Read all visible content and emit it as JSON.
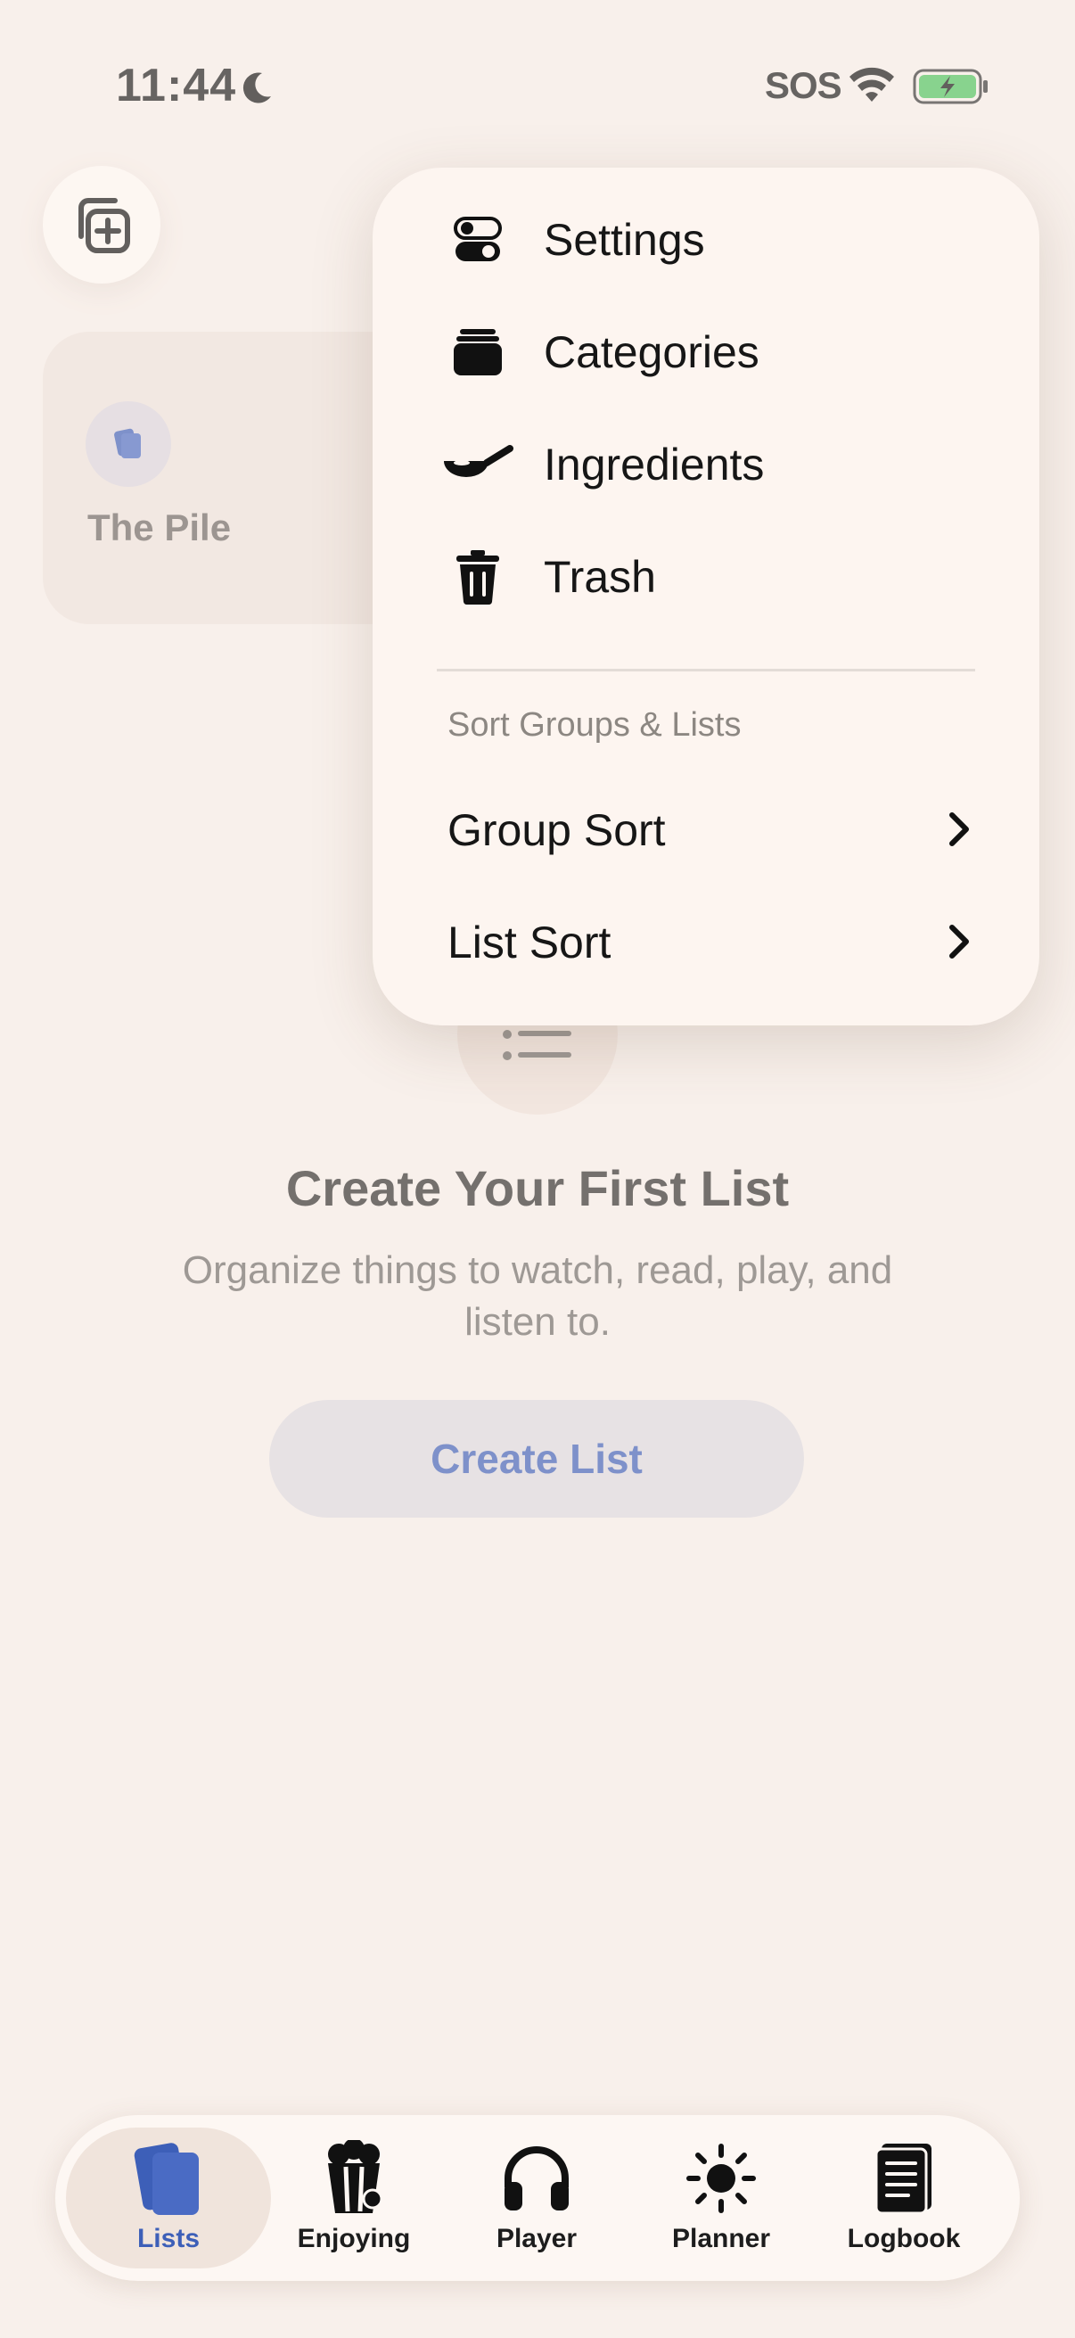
{
  "status_bar": {
    "time": "11:44",
    "carrier": "SOS"
  },
  "pile": {
    "title": "The Pile"
  },
  "empty_state": {
    "title": "Create Your First List",
    "subtitle": "Organize things to watch, read, play, and listen to.",
    "button_label": "Create List"
  },
  "menu": {
    "items": [
      {
        "label": "Settings",
        "icon": "toggles-icon"
      },
      {
        "label": "Categories",
        "icon": "stack-icon"
      },
      {
        "label": "Ingredients",
        "icon": "frying-pan-icon"
      },
      {
        "label": "Trash",
        "icon": "trash-icon"
      }
    ],
    "section_title": "Sort Groups & Lists",
    "sort_items": [
      {
        "label": "Group Sort"
      },
      {
        "label": "List Sort"
      }
    ]
  },
  "tabbar": {
    "tabs": [
      {
        "label": "Lists",
        "icon": "cards-icon",
        "active": true
      },
      {
        "label": "Enjoying",
        "icon": "popcorn-icon",
        "active": false
      },
      {
        "label": "Player",
        "icon": "headphones-icon",
        "active": false
      },
      {
        "label": "Planner",
        "icon": "sun-icon",
        "active": false
      },
      {
        "label": "Logbook",
        "icon": "notebook-icon",
        "active": false
      }
    ]
  },
  "colors": {
    "background": "#f8f0eb",
    "accent": "#3d5fb8",
    "menu_bg": "#fdf5f0",
    "battery_green": "#4cc45c"
  }
}
